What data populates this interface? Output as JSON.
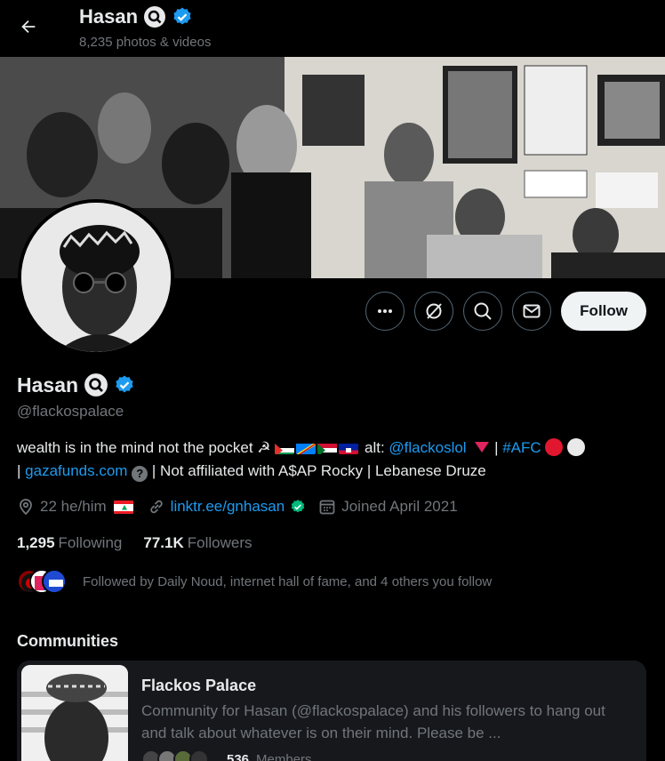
{
  "header": {
    "name": "Hasan",
    "subtitle": "8,235 photos & videos"
  },
  "profile": {
    "name": "Hasan",
    "handle": "@flackospalace",
    "follow_label": "Follow",
    "bio": {
      "part1": "wealth is in the mind not the pocket ☭",
      "alt_prefix": "alt:",
      "alt_link": "@flackoslol",
      "sep1": "|",
      "hashtag": "#AFC",
      "sep2": "|",
      "site_link": "gazafunds.com",
      "qmark": "?",
      "part2": "| Not affiliated with A$AP Rocky | Lebanese Druze"
    },
    "meta": {
      "location": "22 he/him",
      "website": "linktr.ee/gnhasan",
      "joined": "Joined April 2021"
    },
    "stats": {
      "following_count": "1,295",
      "following_label": "Following",
      "followers_count": "77.1K",
      "followers_label": "Followers"
    },
    "followed_by": "Followed by Daily Noud, internet hall of fame, and 4 others you follow"
  },
  "communities": {
    "title": "Communities",
    "items": [
      {
        "name": "Flackos Palace",
        "description": "Community for Hasan (@flackospalace) and his followers to hang out and talk about whatever is on their mind. Please be ...",
        "members_count": "536",
        "members_label": "Members"
      }
    ]
  },
  "icons": {
    "back": "arrow-left-icon",
    "more": "more-dots-icon",
    "grok": "grok-icon",
    "search": "search-icon",
    "message": "envelope-icon",
    "location": "location-pin-icon",
    "link": "link-icon",
    "calendar": "calendar-icon",
    "verified": "verified-badge-icon",
    "magnifier_badge": "magnifier-badge-icon"
  },
  "colors": {
    "accent": "#1d9bf0",
    "verified": "#1d9bf0",
    "bg": "#000000",
    "muted": "#71767b"
  }
}
